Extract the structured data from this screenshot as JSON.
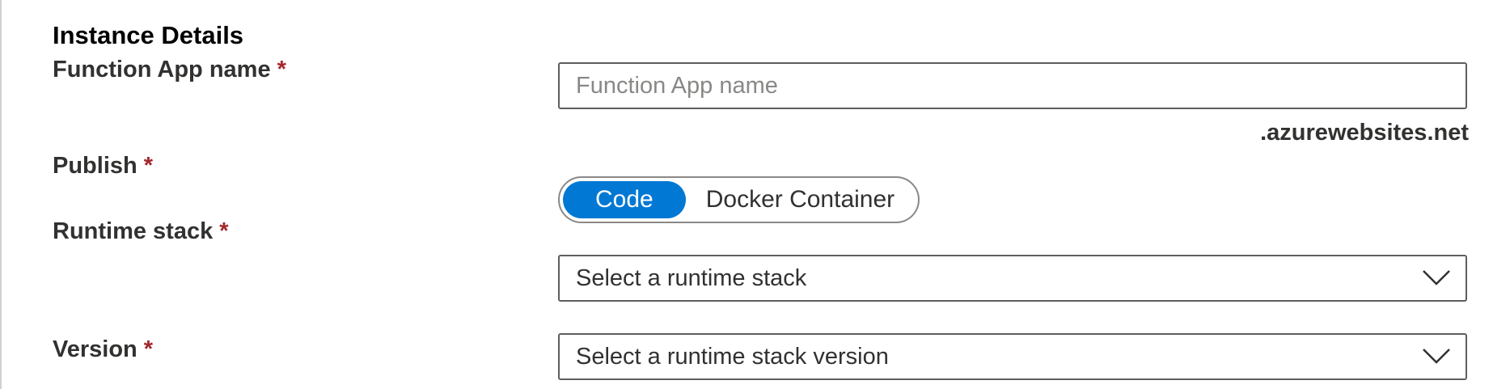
{
  "section": {
    "title": "Instance Details"
  },
  "required_marker": "*",
  "fields": {
    "function_app_name": {
      "label": "Function App name",
      "placeholder": "Function App name",
      "value": "",
      "suffix": ".azurewebsites.net"
    },
    "publish": {
      "label": "Publish",
      "options": [
        "Code",
        "Docker Container"
      ],
      "selected": "Code"
    },
    "runtime_stack": {
      "label": "Runtime stack",
      "value": "Select a runtime stack",
      "icon": "chevron-down-icon"
    },
    "version": {
      "label": "Version",
      "value": "Select a runtime stack version",
      "icon": "chevron-down-icon"
    }
  },
  "colors": {
    "accent": "#0078d4",
    "required": "#a4262c",
    "text": "#323130",
    "placeholder": "#8a8886",
    "border": "#605e5c"
  }
}
